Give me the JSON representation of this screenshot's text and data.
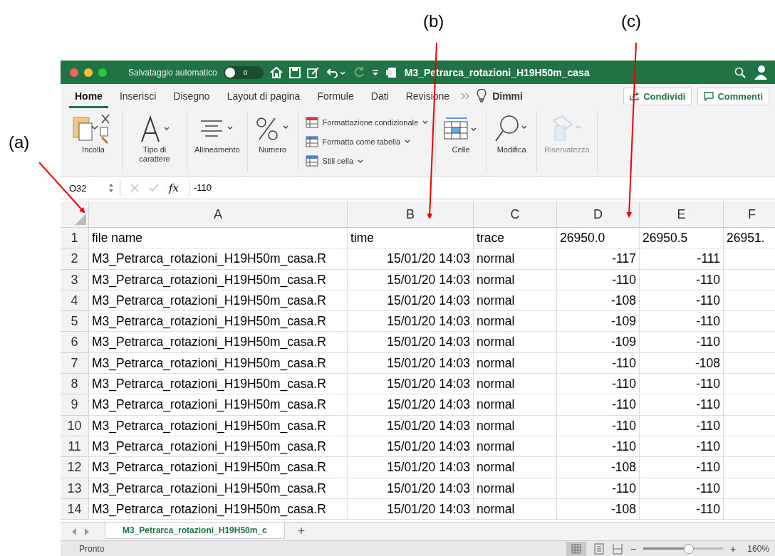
{
  "annotations": [
    {
      "label": "(a)"
    },
    {
      "label": "(b)"
    },
    {
      "label": "(c)"
    }
  ],
  "title_bar": {
    "autosave_label": "Salvataggio automatico",
    "autosave_on": false,
    "toggle_text": "o",
    "title": "M3_Petrarca_rotazioni_H19H50m_casa"
  },
  "tabs": [
    {
      "label": "Home",
      "selected": true
    },
    {
      "label": "Inserisci",
      "selected": false
    },
    {
      "label": "Disegno",
      "selected": false
    },
    {
      "label": "Layout di pagina",
      "selected": false
    },
    {
      "label": "Formule",
      "selected": false
    },
    {
      "label": "Dati",
      "selected": false
    },
    {
      "label": "Revisione",
      "selected": false
    }
  ],
  "tell_me": "Dimmi",
  "share_buttons": [
    {
      "kind": "share",
      "label": "Condividi"
    },
    {
      "kind": "comment",
      "label": "Commenti"
    }
  ],
  "ribbon": [
    {
      "kind": "paste",
      "label": "Incolla",
      "disabled": false
    },
    {
      "kind": "font",
      "label": "Tipo di carattere",
      "disabled": false
    },
    {
      "kind": "align",
      "label": "Allineamento",
      "disabled": false
    },
    {
      "kind": "number",
      "label": "Numero",
      "disabled": false
    },
    {
      "kind": "styles",
      "items": [
        "Formattazione condizionale",
        "Formatta come tabella",
        "Stili cella"
      ],
      "disabled": false
    },
    {
      "kind": "cells",
      "label": "Celle",
      "disabled": false
    },
    {
      "kind": "edit",
      "label": "Modifica",
      "disabled": false
    },
    {
      "kind": "sensitivity",
      "label": "Riservatezza",
      "disabled": true
    }
  ],
  "formula_bar": {
    "name_box": "O32",
    "fx": "fx",
    "formula": "-110"
  },
  "sheet": {
    "columns": [
      {
        "letter": "A"
      },
      {
        "letter": "B"
      },
      {
        "letter": "C"
      },
      {
        "letter": "D"
      },
      {
        "letter": "E"
      },
      {
        "letter": "F"
      }
    ],
    "header_row": {
      "number": "1",
      "cells": [
        "file name",
        "time",
        "trace",
        "26950.0",
        "26950.5",
        "26951."
      ]
    },
    "rows": [
      {
        "number": "2",
        "cells": [
          {
            "kind": "text",
            "value": "M3_Petrarca_rotazioni_H19H50m_casa.R"
          },
          {
            "kind": "number",
            "value": "15/01/20 14:03"
          },
          {
            "kind": "text",
            "value": "normal"
          },
          {
            "kind": "number",
            "value": "-117"
          },
          {
            "kind": "number",
            "value": "-111"
          }
        ]
      },
      {
        "number": "3",
        "cells": [
          {
            "kind": "text",
            "value": "M3_Petrarca_rotazioni_H19H50m_casa.R"
          },
          {
            "kind": "number",
            "value": "15/01/20 14:03"
          },
          {
            "kind": "text",
            "value": "normal"
          },
          {
            "kind": "number",
            "value": "-110"
          },
          {
            "kind": "number",
            "value": "-110"
          }
        ]
      },
      {
        "number": "4",
        "cells": [
          {
            "kind": "text",
            "value": "M3_Petrarca_rotazioni_H19H50m_casa.R"
          },
          {
            "kind": "number",
            "value": "15/01/20 14:03"
          },
          {
            "kind": "text",
            "value": "normal"
          },
          {
            "kind": "number",
            "value": "-108"
          },
          {
            "kind": "number",
            "value": "-110"
          }
        ]
      },
      {
        "number": "5",
        "cells": [
          {
            "kind": "text",
            "value": "M3_Petrarca_rotazioni_H19H50m_casa.R"
          },
          {
            "kind": "number",
            "value": "15/01/20 14:03"
          },
          {
            "kind": "text",
            "value": "normal"
          },
          {
            "kind": "number",
            "value": "-109"
          },
          {
            "kind": "number",
            "value": "-110"
          }
        ]
      },
      {
        "number": "6",
        "cells": [
          {
            "kind": "text",
            "value": "M3_Petrarca_rotazioni_H19H50m_casa.R"
          },
          {
            "kind": "number",
            "value": "15/01/20 14:03"
          },
          {
            "kind": "text",
            "value": "normal"
          },
          {
            "kind": "number",
            "value": "-109"
          },
          {
            "kind": "number",
            "value": "-110"
          }
        ]
      },
      {
        "number": "7",
        "cells": [
          {
            "kind": "text",
            "value": "M3_Petrarca_rotazioni_H19H50m_casa.R"
          },
          {
            "kind": "number",
            "value": "15/01/20 14:03"
          },
          {
            "kind": "text",
            "value": "normal"
          },
          {
            "kind": "number",
            "value": "-110"
          },
          {
            "kind": "number",
            "value": "-108"
          }
        ]
      },
      {
        "number": "8",
        "cells": [
          {
            "kind": "text",
            "value": "M3_Petrarca_rotazioni_H19H50m_casa.R"
          },
          {
            "kind": "number",
            "value": "15/01/20 14:03"
          },
          {
            "kind": "text",
            "value": "normal"
          },
          {
            "kind": "number",
            "value": "-110"
          },
          {
            "kind": "number",
            "value": "-110"
          }
        ]
      },
      {
        "number": "9",
        "cells": [
          {
            "kind": "text",
            "value": "M3_Petrarca_rotazioni_H19H50m_casa.R"
          },
          {
            "kind": "number",
            "value": "15/01/20 14:03"
          },
          {
            "kind": "text",
            "value": "normal"
          },
          {
            "kind": "number",
            "value": "-110"
          },
          {
            "kind": "number",
            "value": "-110"
          }
        ]
      },
      {
        "number": "10",
        "cells": [
          {
            "kind": "text",
            "value": "M3_Petrarca_rotazioni_H19H50m_casa.R"
          },
          {
            "kind": "number",
            "value": "15/01/20 14:03"
          },
          {
            "kind": "text",
            "value": "normal"
          },
          {
            "kind": "number",
            "value": "-110"
          },
          {
            "kind": "number",
            "value": "-110"
          }
        ]
      },
      {
        "number": "11",
        "cells": [
          {
            "kind": "text",
            "value": "M3_Petrarca_rotazioni_H19H50m_casa.R"
          },
          {
            "kind": "number",
            "value": "15/01/20 14:03"
          },
          {
            "kind": "text",
            "value": "normal"
          },
          {
            "kind": "number",
            "value": "-110"
          },
          {
            "kind": "number",
            "value": "-110"
          }
        ]
      },
      {
        "number": "12",
        "cells": [
          {
            "kind": "text",
            "value": "M3_Petrarca_rotazioni_H19H50m_casa.R"
          },
          {
            "kind": "number",
            "value": "15/01/20 14:03"
          },
          {
            "kind": "text",
            "value": "normal"
          },
          {
            "kind": "number",
            "value": "-108"
          },
          {
            "kind": "number",
            "value": "-110"
          }
        ]
      },
      {
        "number": "13",
        "cells": [
          {
            "kind": "text",
            "value": "M3_Petrarca_rotazioni_H19H50m_casa.R"
          },
          {
            "kind": "number",
            "value": "15/01/20 14:03"
          },
          {
            "kind": "text",
            "value": "normal"
          },
          {
            "kind": "number",
            "value": "-110"
          },
          {
            "kind": "number",
            "value": "-110"
          }
        ]
      },
      {
        "number": "14",
        "cells": [
          {
            "kind": "text",
            "value": "M3_Petrarca_rotazioni_H19H50m_casa.R"
          },
          {
            "kind": "number",
            "value": "15/01/20 14:03"
          },
          {
            "kind": "text",
            "value": "normal"
          },
          {
            "kind": "number",
            "value": "-108"
          },
          {
            "kind": "number",
            "value": "-110"
          }
        ]
      }
    ]
  },
  "sheet_tabs": [
    {
      "label": "M3_Petrarca_rotazioni_H19H50m_c",
      "selected": true
    }
  ],
  "add_sheet": "+",
  "status_bar": {
    "text": "Pronto",
    "zoom_out": "−",
    "zoom_in": "+",
    "level": 0.57,
    "zoom": "160%"
  }
}
